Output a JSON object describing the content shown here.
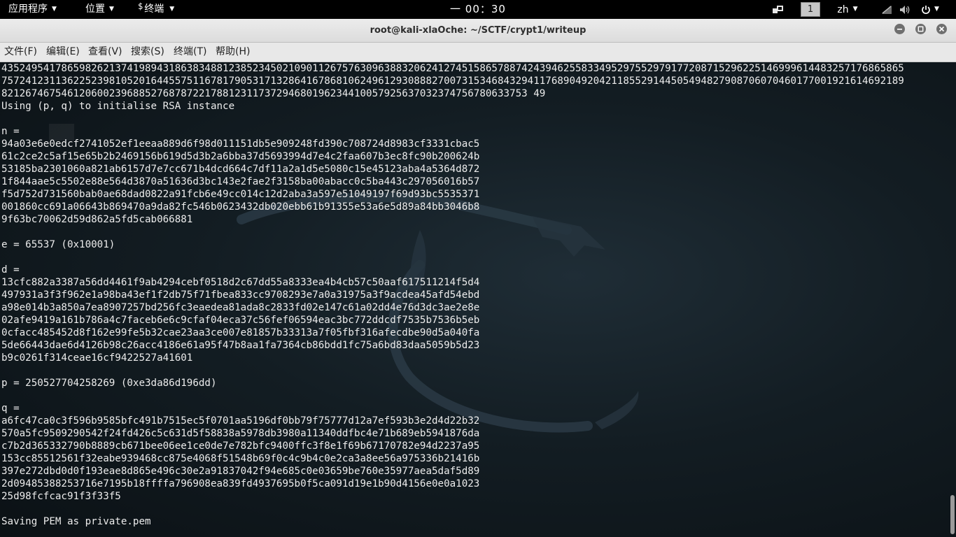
{
  "top_panel": {
    "applications": "应用程序",
    "places": "位置",
    "terminal_app_icon": "$",
    "terminal_app": "终端",
    "clock": "一 00：30",
    "workspace": "1",
    "language": "zh"
  },
  "window": {
    "title": "root@kali-xlaOche: ~/SCTF/crypt1/writeup"
  },
  "menubar": {
    "file": "文件(F)",
    "edit": "编辑(E)",
    "view": "查看(V)",
    "search": "搜索(S)",
    "terminal": "终端(T)",
    "help": "帮助(H)"
  },
  "terminal": {
    "lines": [
      "4352495417865982621374198943186383488123852345021090112675763096388320624127451586578874243946255833495297552979177208715296225146999614483257176865865",
      "7572412311362252398105201644557511678179053171328641678681062496129308882700731534684329411768904920421185529144505494827908706070460177001921614692189",
      "8212674675461206002396885276878722178812311737294680196234410057925637032374756780633753 49",
      "Using (p, q) to initialise RSA instance",
      "",
      "n =",
      "94a03e6e0edcf2741052ef1eeaa889d6f98d011151db5e909248fd390c708724d8983cf3331cbac5",
      "61c2ce2c5af15e65b2b2469156b619d5d3b2a6bba37d5693994d7e4c2faa607b3ec8fc90b200624b",
      "53185ba2301060a821ab6157d7e7cc671b4dcd664c7df11a2a1d5e5080c15e45123aba4a5364d872",
      "1f844aae5c5502e88e564d3870a51636d3bc143e2fae2f3158ba00abacc0c5ba443c297056016b57",
      "f5d752d731560bab0ae68dad0822a91fcb6e49cc014c12d2aba3a597e51049197f69d93bc5535371",
      "001860cc691a06643b869470a9da82fc546b0623432db020ebb61b91355e53a6e5d89a84bb3046b8",
      "9f63bc70062d59d862a5fd5cab066881",
      "",
      "e = 65537 (0x10001)",
      "",
      "d =",
      "13cfc882a3387a56dd4461f9ab4294cebf0518d2c67dd55a8333ea4b4cb57c50aaf617511214f5d4",
      "497931a3f3f962e1a98ba43ef1f2db75f71fbea833cc9708293e7a0a31975a3f9acdea45afd54ebd",
      "a98e014b3a850a7ea8907257bd256fc3eaedea81ada8c2833fd02e147c61a02dd4e76d3dc3ae2e8e",
      "02afe9419a161b786a4c7faceb6e6c9cfaf04eca37c56fef06594eac3bc772ddcdf7535b7536b5eb",
      "0cfacc485452d8f162e99fe5b32cae23aa3ce007e81857b33313a7f05fbf316afecdbe90d5a040fa",
      "5de66443dae6d4126b98c26acc4186e61a95f47b8aa1fa7364cb86bdd1fc75a6bd83daa5059b5d23",
      "b9c0261f314ceae16cf9422527a41601",
      "",
      "p = 250527704258269 (0xe3da86d196dd)",
      "",
      "q =",
      "a6fc47ca0c3f596b9585bfc491b7515ec5f0701aa5196df0bb79f75777d12a7ef593b3e2d4d22b32",
      "570a5fc9509290542f24fd426c5c631d5f58838a5978db3980a11340ddfbc4e71b689eb5941876da",
      "c7b2d365332790b8889cb671bee06ee1ce0de7e782bfc9400ffc3f8e1f69b67170782e94d2237a95",
      "153cc85512561f32eabe939468cc875e4068f51548b69f0c4c9b4c0e2ca3a8ee56a975336b21416b",
      "397e272dbd0d0f193eae8d865e496c30e2a91837042f94e685c0e03659be760e35977aea5daf5d89",
      "2d09485388253716e7195b18ffffa796908ea839fd4937695b0f5ca091d19e1b90d4156e0e0a1023",
      "25d98fcfcac91f3f33f5",
      "",
      "Saving PEM as private.pem"
    ]
  },
  "colors": {
    "terminal_fg": "#ececec",
    "panel_bg": "#000000"
  }
}
